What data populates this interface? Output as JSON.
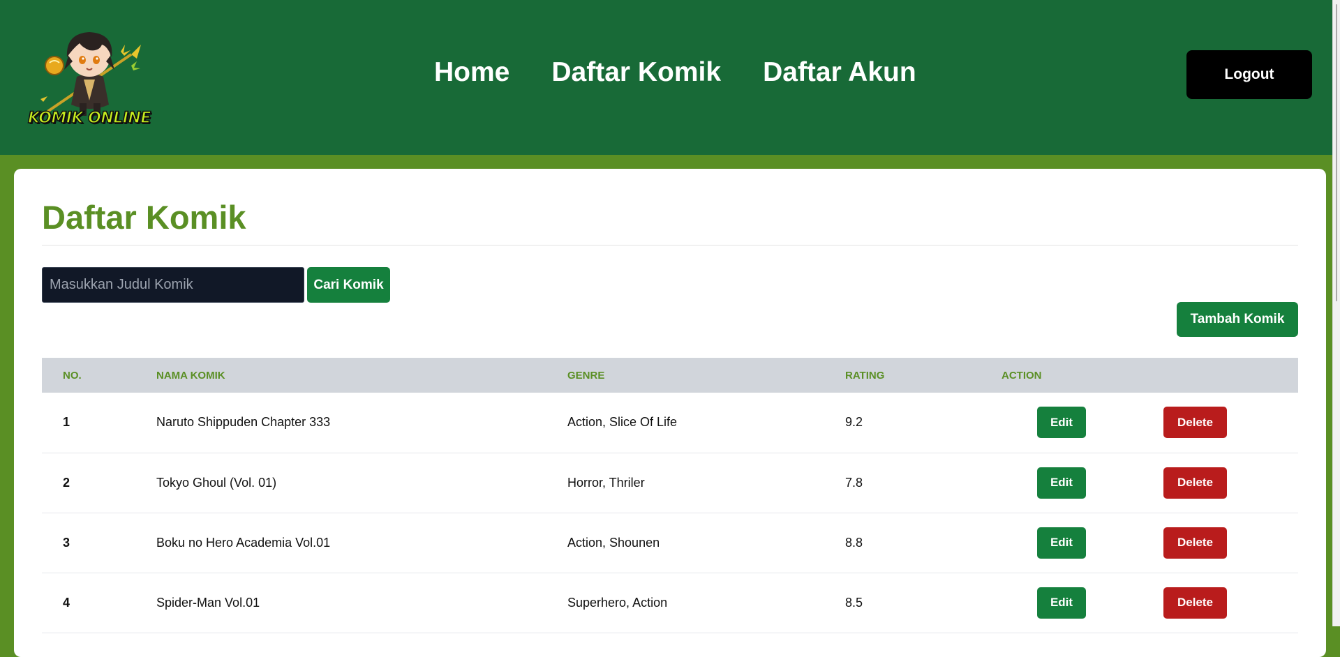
{
  "header": {
    "logo_text": "KOMIK ONLINE",
    "nav": [
      {
        "label": "Home"
      },
      {
        "label": "Daftar Komik"
      },
      {
        "label": "Daftar Akun"
      }
    ],
    "logout_label": "Logout"
  },
  "main": {
    "title": "Daftar Komik",
    "search_placeholder": "Masukkan Judul Komik",
    "search_value": "",
    "search_button": "Cari Komik",
    "add_button": "Tambah Komik",
    "table": {
      "columns": [
        "No.",
        "Nama Komik",
        "Genre",
        "Rating",
        "Action"
      ],
      "rows": [
        {
          "no": "1",
          "name": "Naruto Shippuden Chapter 333",
          "genre": "Action, Slice Of Life",
          "rating": "9.2",
          "edit": "Edit",
          "delete": "Delete"
        },
        {
          "no": "2",
          "name": "Tokyo Ghoul (Vol. 01)",
          "genre": "Horror, Thriler",
          "rating": "7.8",
          "edit": "Edit",
          "delete": "Delete"
        },
        {
          "no": "3",
          "name": "Boku no Hero Academia Vol.01",
          "genre": "Action, Shounen",
          "rating": "8.8",
          "edit": "Edit",
          "delete": "Delete"
        },
        {
          "no": "4",
          "name": "Spider-Man Vol.01",
          "genre": "Superhero, Action",
          "rating": "8.5",
          "edit": "Edit",
          "delete": "Delete"
        }
      ]
    }
  },
  "colors": {
    "header_bg": "#186a37",
    "page_bg": "#5a8f24",
    "accent_green": "#15803d",
    "title_green": "#5a8f24",
    "delete_red": "#b91c1c",
    "search_bg": "#111827"
  },
  "icons": {
    "logo": "chibi-character-logo"
  }
}
